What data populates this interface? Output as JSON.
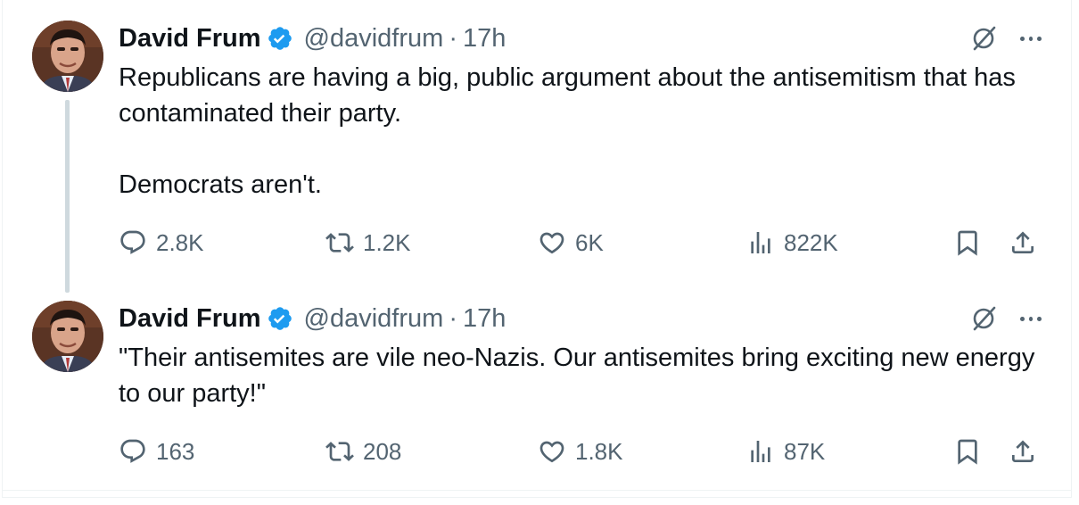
{
  "colors": {
    "text_primary": "#0f1419",
    "text_secondary": "#536471",
    "verified_blue": "#1d9bf0",
    "thread_line": "#cfd9de"
  },
  "tweets": [
    {
      "author_name": "David Frum",
      "handle": "@davidfrum",
      "separator": "·",
      "time": "17h",
      "body": [
        "Republicans are having a big, public argument about the antisemitism that has contaminated their party.",
        "Democrats aren't."
      ],
      "replies": "2.8K",
      "reposts": "1.2K",
      "likes": "6K",
      "views": "822K"
    },
    {
      "author_name": "David Frum",
      "handle": "@davidfrum",
      "separator": "·",
      "time": "17h",
      "body": [
        "\"Their antisemites are vile neo-Nazis. Our antisemites bring exciting new energy to our party!\""
      ],
      "replies": "163",
      "reposts": "208",
      "likes": "1.8K",
      "views": "87K"
    }
  ]
}
